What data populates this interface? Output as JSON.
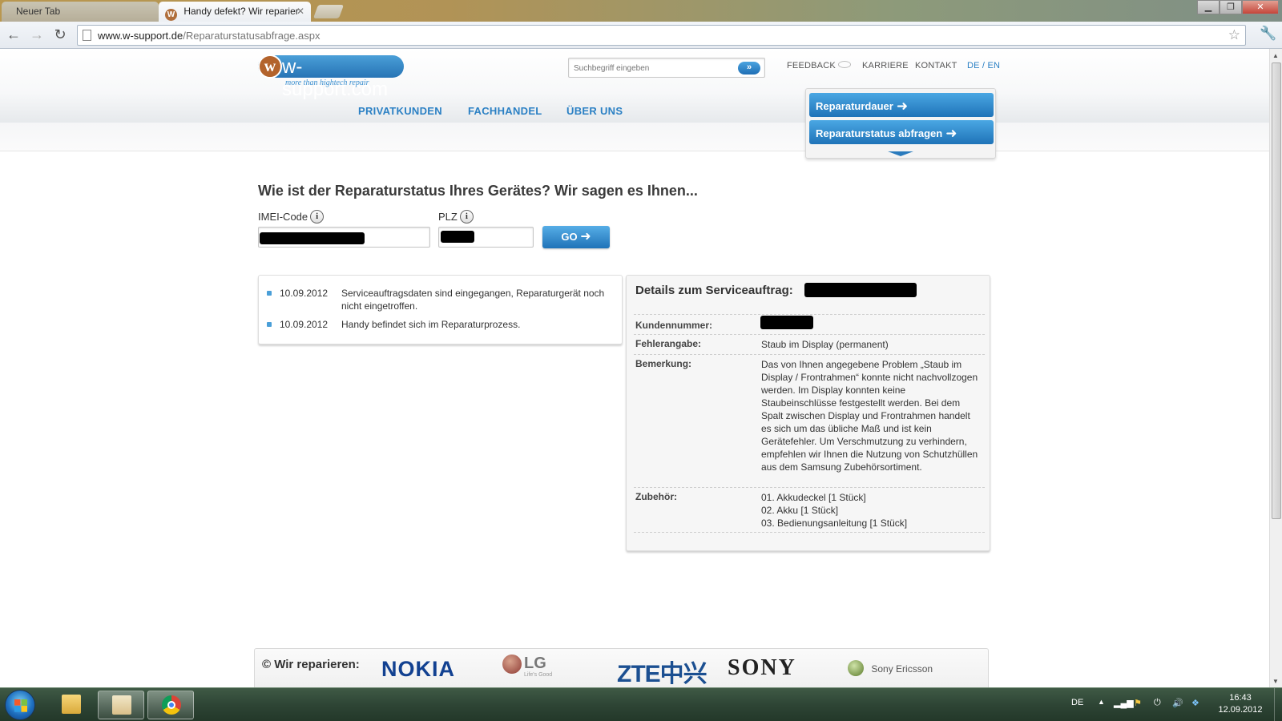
{
  "browser": {
    "tabs": [
      {
        "label": "Neuer Tab",
        "active": false
      },
      {
        "label": "Handy defekt? Wir reparier",
        "active": true
      }
    ],
    "url_domain": "www.w-support.de",
    "url_path": "/Reparaturstatusabfrage.aspx"
  },
  "header": {
    "logo_name": "w-support.com",
    "logo_letter": "w",
    "logo_tagline": "more than hightech repair",
    "search_placeholder": "Suchbegriff eingeben",
    "toplinks": {
      "feedback": "FEEDBACK",
      "karriere": "KARRIERE",
      "kontakt": "KONTAKT",
      "language": "DE / EN"
    },
    "nav": [
      "PRIVATKUNDEN",
      "FACHHANDEL",
      "ÜBER UNS"
    ],
    "quick_buttons": [
      "Reparaturdauer",
      "Reparaturstatus abfragen"
    ]
  },
  "form": {
    "title": "Wie ist der Reparaturstatus Ihres Gerätes? Wir sagen es Ihnen...",
    "imei_label": "IMEI-Code",
    "plz_label": "PLZ",
    "go_label": "GO"
  },
  "timeline": [
    {
      "date": "10.09.2012",
      "text": "Serviceauftragsdaten sind eingegangen, Reparaturgerät noch nicht eingetroffen."
    },
    {
      "date": "10.09.2012",
      "text": "Handy befindet sich im Reparaturprozess."
    }
  ],
  "details": {
    "title": "Details zum Serviceauftrag:",
    "kundennummer_label": "Kundennummer:",
    "fehlerangabe_label": "Fehlerangabe:",
    "fehlerangabe_value": "Staub im Display (permanent)",
    "bemerkung_label": "Bemerkung:",
    "bemerkung_value": "Das von Ihnen angegebene Problem „Staub im Display / Frontrahmen“ konnte nicht nachvollzogen werden. Im Display konnten keine Staubeinschlüsse festgestellt werden. Bei dem Spalt zwischen Display und Frontrahmen handelt es sich um das übliche Maß und ist kein Gerätefehler. Um Verschmutzung zu verhindern, empfehlen wir Ihnen die Nutzung von Schutzhüllen aus dem Samsung Zubehörsortiment.",
    "zubehoer_label": "Zubehör:",
    "zubehoer_items": [
      "01. Akkudeckel [1 Stück]",
      "02. Akku [1 Stück]",
      "03. Bedienungsanleitung [1 Stück]"
    ]
  },
  "brands": {
    "label": "© Wir reparieren:",
    "logos": [
      "NOKIA",
      "LG",
      "Life's Good",
      "ZTE中兴",
      "SONY",
      "Sony Ericsson"
    ]
  },
  "taskbar": {
    "language": "DE",
    "time": "16:43",
    "date": "12.09.2012"
  },
  "colors": {
    "brand_blue": "#2b80c4",
    "button_blue": "#1f73b8",
    "logo_brown": "#b3632c",
    "taskbar_green": "#2e4535"
  }
}
